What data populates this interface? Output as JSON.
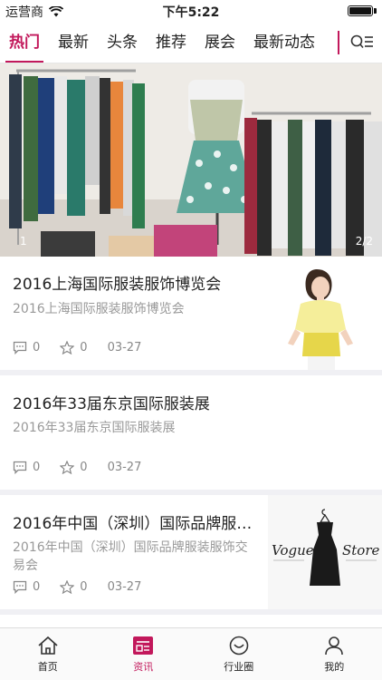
{
  "status_bar": {
    "carrier": "运营商",
    "time": "下午5:22"
  },
  "tabs": [
    {
      "label": "热门",
      "active": true
    },
    {
      "label": "最新",
      "active": false
    },
    {
      "label": "头条",
      "active": false
    },
    {
      "label": "推荐",
      "active": false
    },
    {
      "label": "展会",
      "active": false
    },
    {
      "label": "最新动态",
      "active": false
    }
  ],
  "banner": {
    "counter_left": "1",
    "counter": "2/2"
  },
  "articles": [
    {
      "title": "2016上海国际服装服饰博览会",
      "description": "2016上海国际服装服饰博览会",
      "comments": "0",
      "favorites": "0",
      "date": "03-27"
    },
    {
      "title": "2016年33届东京国际服装展",
      "description": "2016年33届东京国际服装展",
      "comments": "0",
      "favorites": "0",
      "date": "03-27"
    },
    {
      "title": "2016年中国（深圳）国际品牌服…",
      "description": "2016年中国（深圳）国际品牌服装服饰交易会",
      "comments": "0",
      "favorites": "0",
      "date": "03-27",
      "thumb_brand_1": "Vogue",
      "thumb_brand_2": "Store"
    }
  ],
  "bottom_nav": [
    {
      "label": "首页",
      "icon": "home-icon",
      "active": false
    },
    {
      "label": "资讯",
      "icon": "news-icon",
      "active": true
    },
    {
      "label": "行业圈",
      "icon": "circle-icon",
      "active": false
    },
    {
      "label": "我的",
      "icon": "user-icon",
      "active": false
    }
  ],
  "colors": {
    "accent": "#c2185b",
    "muted": "#999999",
    "separator": "#f0f0f4"
  }
}
